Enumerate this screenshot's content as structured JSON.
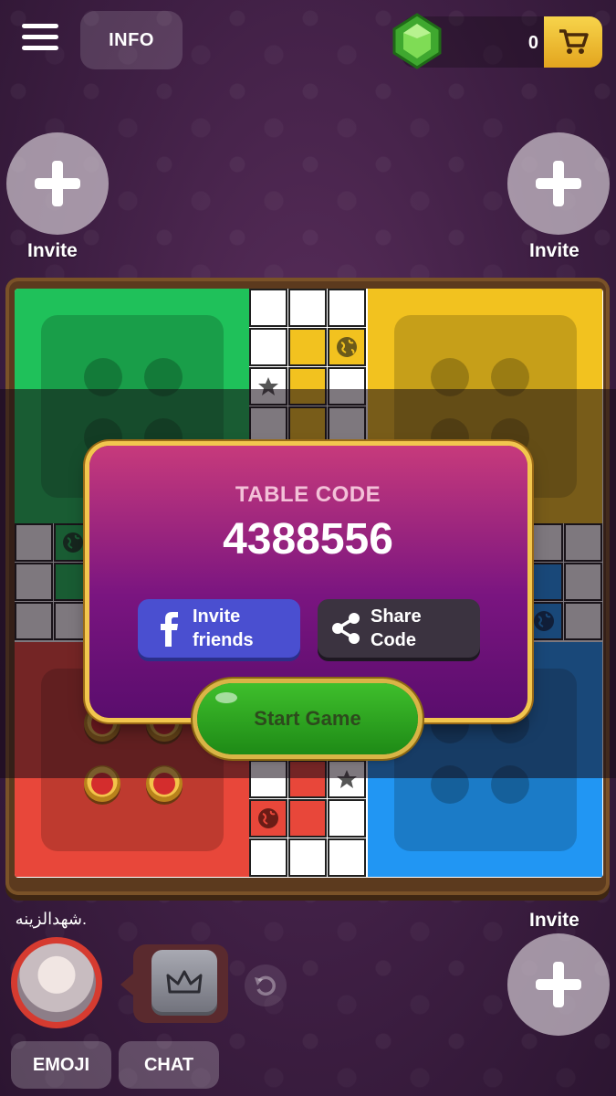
{
  "header": {
    "info_label": "INFO",
    "gem_count": "0"
  },
  "invites": {
    "top_left_label": "Invite",
    "top_right_label": "Invite",
    "bottom_right_label": "Invite"
  },
  "board": {
    "colors": {
      "green": "#1fc15a",
      "yellow": "#f2c21f",
      "red": "#e8473a",
      "blue": "#2196f3"
    }
  },
  "dialog": {
    "title": "TABLE CODE",
    "code": "4388556",
    "invite_line1": "Invite",
    "invite_line2": "friends",
    "share_line1": "Share",
    "share_line2": "Code",
    "start_label": "Start Game"
  },
  "player": {
    "name": "شهدالزينه."
  },
  "bottom": {
    "emoji_label": "EMOJI",
    "chat_label": "CHAT"
  }
}
